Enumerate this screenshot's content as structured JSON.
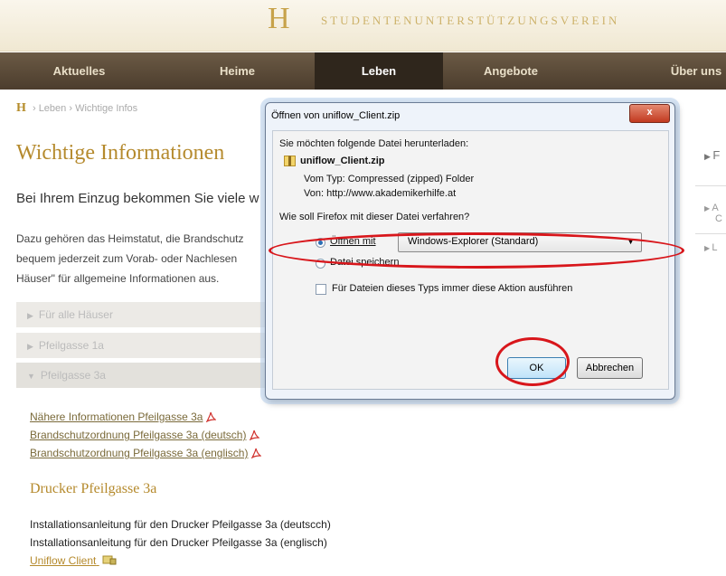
{
  "header": {
    "logo_glyph": "H",
    "org_name": "STUDENTENUNTERSTÜTZUNGSVEREIN"
  },
  "nav": {
    "items": [
      {
        "label": "Aktuelles"
      },
      {
        "label": "Heime"
      },
      {
        "label": "Leben"
      },
      {
        "label": "Angebote"
      },
      {
        "label": "Über uns"
      }
    ],
    "active": "Leben"
  },
  "breadcrumb": {
    "home": "H",
    "separator": "›",
    "items": [
      "Leben",
      "Wichtige Infos"
    ]
  },
  "page": {
    "title": "Wichtige Informationen",
    "lead": "Bei Ihrem Einzug bekommen Sie viele w",
    "intro_line1": "Dazu gehören das Heimstatut, die Brandschutz",
    "intro_line2": "bequem jederzeit zum Vorab- oder Nachlesen",
    "intro_line3": "Häuser\" für allgemeine Informationen aus."
  },
  "accordion": [
    {
      "label": "Für alle Häuser",
      "expanded": false
    },
    {
      "label": "Pfeilgasse 1a",
      "expanded": false
    },
    {
      "label": "Pfeilgasse 3a",
      "expanded": true
    }
  ],
  "documents": [
    {
      "label": "Nähere Informationen Pfeilgasse 3a"
    },
    {
      "label": "Brandschutzordnung Pfeilgasse 3a (deutsch)"
    },
    {
      "label": "Brandschutzordnung Pfeilgasse 3a (englisch)"
    }
  ],
  "printer_section": {
    "title": "Drucker Pfeilgasse 3a",
    "line1": "Installationsanleitung für den Drucker Pfeilgasse 3a (deutscch)",
    "line2": "Installationsanleitung für den Drucker Pfeilgasse 3a (englisch)",
    "client_link": "Uniflow Client"
  },
  "right_column": {
    "item1": "F",
    "item2a": "A",
    "item2b": "C",
    "item3": "L"
  },
  "dialog": {
    "title": "Öffnen von uniflow_Client.zip",
    "close_label": "x",
    "prompt": "Sie möchten folgende Datei herunterladen:",
    "filename": "uniflow_Client.zip",
    "type_label": "Vom Typ:",
    "type_value": "Compressed (zipped) Folder",
    "from_label": "Von:",
    "from_value": "http://www.akademikerhilfe.at",
    "question": "Wie soll Firefox mit dieser Datei verfahren?",
    "open_with_label": "Öffnen mit",
    "open_with_value": "Windows-Explorer (Standard)",
    "save_label": "Datei speichern",
    "remember_label": "Für Dateien dieses Typs immer diese Aktion ausführen",
    "ok_label": "OK",
    "cancel_label": "Abbrechen",
    "selected_action": "open_with",
    "remember_checked": false
  },
  "colors": {
    "accent": "#b58a2d",
    "nav_bg": "#5a4936",
    "highlight": "#d8161b"
  }
}
